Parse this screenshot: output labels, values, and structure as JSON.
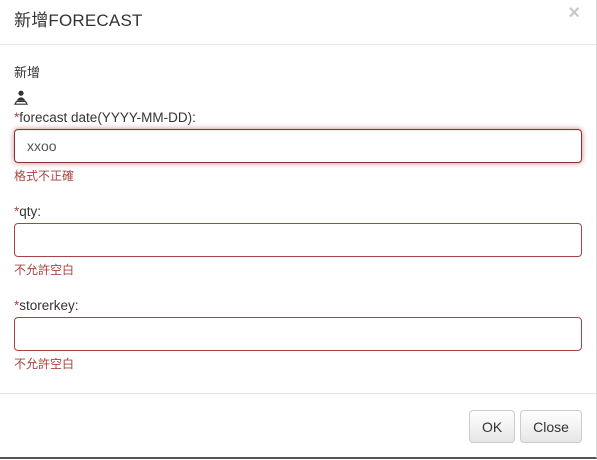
{
  "dialog": {
    "title": "新增FORECAST",
    "close_symbol": "×"
  },
  "form": {
    "section_title": "新增",
    "icon": "user-icon",
    "required_mark": "*",
    "fields": [
      {
        "label": "forecast date(YYYY-MM-DD):",
        "value": "xxoo",
        "placeholder": "",
        "error": "格式不正確"
      },
      {
        "label": "qty:",
        "value": "",
        "placeholder": "",
        "error": "不允許空白"
      },
      {
        "label": "storerkey:",
        "value": "",
        "placeholder": "",
        "error": "不允許空白"
      }
    ]
  },
  "footer": {
    "ok_label": "OK",
    "close_label": "Close"
  },
  "colors": {
    "error": "#a94442",
    "border": "#e5e5e5"
  }
}
